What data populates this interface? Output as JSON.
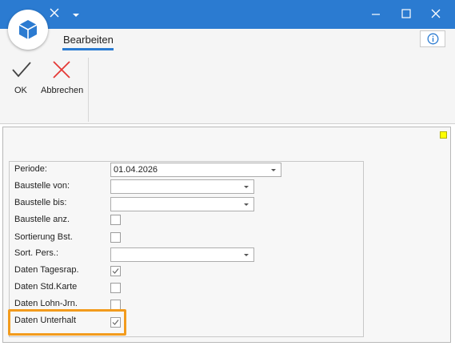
{
  "ribbon": {
    "tab_label": "Bearbeiten",
    "ok_label": "OK",
    "cancel_label": "Abbrechen"
  },
  "form": {
    "periode_label": "Periode:",
    "periode_value": "01.04.2026",
    "baustelle_von_label": "Baustelle von:",
    "baustelle_von_value": "",
    "baustelle_bis_label": "Baustelle bis:",
    "baustelle_bis_value": "",
    "baustelle_anz_label": "Baustelle anz.",
    "baustelle_anz_checked": false,
    "sortierung_label": "Sortierung Bst.",
    "sortierung_checked": false,
    "sort_pers_label": "Sort. Pers.:",
    "sort_pers_value": "",
    "tagesrap_label": "Daten Tagesrap.",
    "tagesrap_checked": true,
    "stdkarte_label": "Daten Std.Karte",
    "stdkarte_checked": false,
    "lohnjrn_label": "Daten Lohn-Jrn.",
    "lohnjrn_checked": false,
    "unterhalt_label": "Daten Unterhalt",
    "unterhalt_checked": true
  },
  "colors": {
    "titlebar": "#2b7bd1",
    "highlight": "#f29b1d",
    "cancel_red": "#e53935",
    "marker_yellow": "#ffff00"
  },
  "icons": {
    "logo": "cube-icon",
    "close_small": "close-icon",
    "dropdown": "chevron-down-icon",
    "minimize": "minimize-icon",
    "maximize": "maximize-icon",
    "close": "close-icon",
    "info": "info-icon",
    "ok": "checkmark-icon",
    "cancel": "cross-icon"
  }
}
